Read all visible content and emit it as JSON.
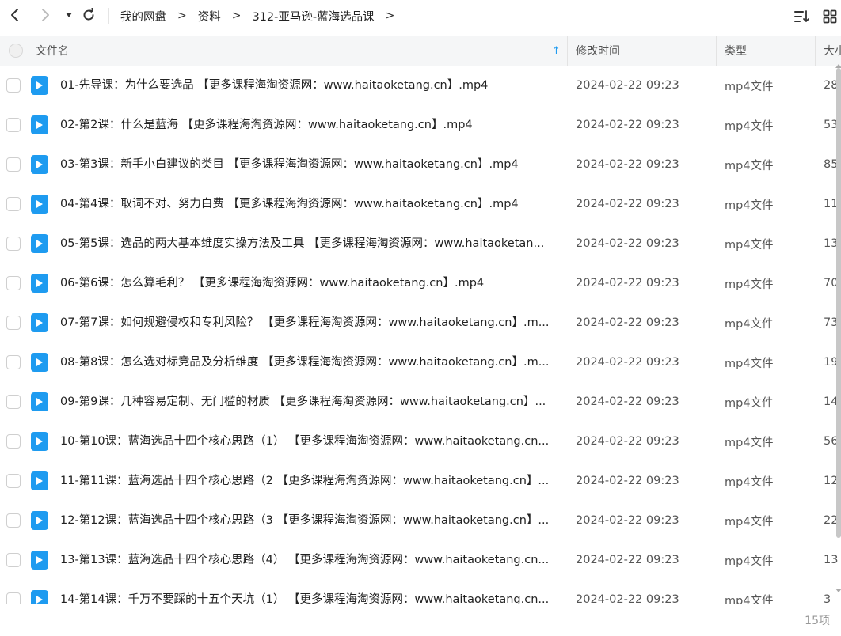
{
  "toolbar": {
    "back_icon": "chevron-left-icon",
    "forward_icon": "chevron-right-icon",
    "history_icon": "dropdown-triangle-icon",
    "refresh_icon": "refresh-icon",
    "sort_icon": "sort-list-icon",
    "view_icon": "grid-view-icon"
  },
  "breadcrumb": [
    "我的网盘",
    "资料",
    "312-亚马逊-蓝海选品课"
  ],
  "breadcrumb_separator": ">",
  "columns": {
    "name": "文件名",
    "modified": "修改时间",
    "type": "类型",
    "size": "大小"
  },
  "sort_indicator": "↑",
  "files": [
    {
      "name": "01-先导课：为什么要选品 【更多课程海淘资源网：www.haitaoketang.cn】.mp4",
      "modified": "2024-02-22 09:23",
      "type": "mp4文件",
      "size": "28"
    },
    {
      "name": "02-第2课：什么是蓝海 【更多课程海淘资源网：www.haitaoketang.cn】.mp4",
      "modified": "2024-02-22 09:23",
      "type": "mp4文件",
      "size": "53"
    },
    {
      "name": "03-第3课：新手小白建议的类目 【更多课程海淘资源网：www.haitaoketang.cn】.mp4",
      "modified": "2024-02-22 09:23",
      "type": "mp4文件",
      "size": "85"
    },
    {
      "name": "04-第4课：取词不对、努力白费 【更多课程海淘资源网：www.haitaoketang.cn】.mp4",
      "modified": "2024-02-22 09:23",
      "type": "mp4文件",
      "size": "11"
    },
    {
      "name": "05-第5课：选品的两大基本维度实操方法及工具 【更多课程海淘资源网：www.haitaoketan...",
      "modified": "2024-02-22 09:23",
      "type": "mp4文件",
      "size": "13"
    },
    {
      "name": "06-第6课：怎么算毛利？ 【更多课程海淘资源网：www.haitaoketang.cn】.mp4",
      "modified": "2024-02-22 09:23",
      "type": "mp4文件",
      "size": "70"
    },
    {
      "name": "07-第7课：如何规避侵权和专利风险？ 【更多课程海淘资源网：www.haitaoketang.cn】.m...",
      "modified": "2024-02-22 09:23",
      "type": "mp4文件",
      "size": "73"
    },
    {
      "name": "08-第8课：怎么选对标竞品及分析维度 【更多课程海淘资源网：www.haitaoketang.cn】.m...",
      "modified": "2024-02-22 09:23",
      "type": "mp4文件",
      "size": "19"
    },
    {
      "name": "09-第9课：几种容易定制、无门槛的材质 【更多课程海淘资源网：www.haitaoketang.cn】...",
      "modified": "2024-02-22 09:23",
      "type": "mp4文件",
      "size": "14"
    },
    {
      "name": "10-第10课：蓝海选品十四个核心思路（1） 【更多课程海淘资源网：www.haitaoketang.cn...",
      "modified": "2024-02-22 09:23",
      "type": "mp4文件",
      "size": "56"
    },
    {
      "name": "11-第11课：蓝海选品十四个核心思路（2 【更多课程海淘资源网：www.haitaoketang.cn】...",
      "modified": "2024-02-22 09:23",
      "type": "mp4文件",
      "size": "12"
    },
    {
      "name": "12-第12课：蓝海选品十四个核心思路（3 【更多课程海淘资源网：www.haitaoketang.cn】...",
      "modified": "2024-02-22 09:23",
      "type": "mp4文件",
      "size": "22"
    },
    {
      "name": "13-第13课：蓝海选品十四个核心思路（4） 【更多课程海淘资源网：www.haitaoketang.cn...",
      "modified": "2024-02-22 09:23",
      "type": "mp4文件",
      "size": "13"
    },
    {
      "name": "14-第14课：千万不要踩的十五个天坑（1） 【更多课程海淘资源网：www.haitaoketang.cn...",
      "modified": "2024-02-22 09:23",
      "type": "mp4文件",
      "size": "3"
    }
  ],
  "file_icon": "video-file-icon",
  "status": {
    "count": "15项"
  },
  "colors": {
    "accent": "#1e9bf0",
    "header_bg": "#f5f6f7"
  }
}
